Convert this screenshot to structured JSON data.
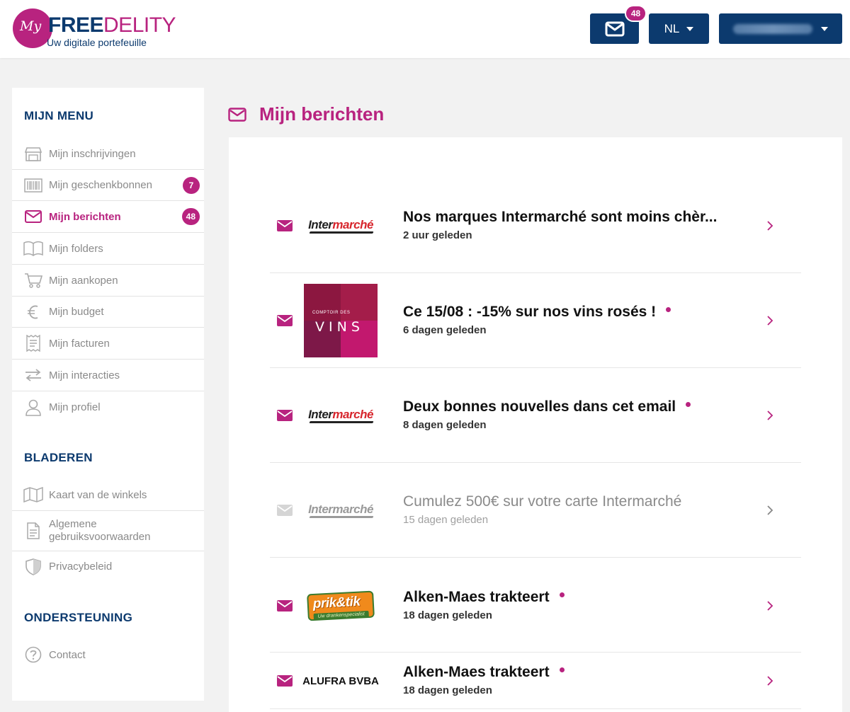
{
  "header": {
    "logo": {
      "my": "My",
      "free": "FREE",
      "delity": "DELITY",
      "tagline": "Uw digitale portefeuille"
    },
    "mail_badge": "48",
    "language": "NL",
    "user_name": "",
    "icons": {
      "mail": "envelope-icon",
      "caret": "caret-down-icon"
    }
  },
  "sidebar": {
    "menu_title": "MIJN MENU",
    "menu_items": [
      {
        "label": "Mijn inschrijvingen",
        "icon": "store-icon"
      },
      {
        "label": "Mijn geschenkbonnen",
        "icon": "barcode-icon",
        "badge": "7"
      },
      {
        "label": "Mijn berichten",
        "icon": "envelope-icon",
        "badge": "48",
        "active": true
      },
      {
        "label": "Mijn folders",
        "icon": "book-open-icon"
      },
      {
        "label": "Mijn aankopen",
        "icon": "cart-icon"
      },
      {
        "label": "Mijn budget",
        "icon": "euro-icon"
      },
      {
        "label": "Mijn facturen",
        "icon": "receipt-icon"
      },
      {
        "label": "Mijn interacties",
        "icon": "exchange-icon"
      },
      {
        "label": "Mijn profiel",
        "icon": "user-icon"
      }
    ],
    "browse_title": "BLADEREN",
    "browse_items": [
      {
        "label": "Kaart van de winkels",
        "icon": "map-icon"
      },
      {
        "label": "Algemene gebruiksvoorwaarden",
        "icon": "document-icon"
      },
      {
        "label": "Privacybeleid",
        "icon": "shield-icon"
      }
    ],
    "support_title": "ONDERSTEUNING",
    "support_items": [
      {
        "label": "Contact",
        "icon": "question-circle-icon"
      }
    ]
  },
  "main": {
    "title": "Mijn berichten",
    "messages": [
      {
        "brand": "intermarche",
        "brand_parts": [
          "Inter",
          "marché"
        ],
        "title": "Nos marques Intermarché sont moins chèr...",
        "time": "2 uur geleden",
        "unread_dot": false,
        "read": false
      },
      {
        "brand": "comptoir-des-vins",
        "brand_parts": [
          "COMPTOIR DES",
          "VINS"
        ],
        "title": "Ce 15/08 : -15% sur nos vins rosés !",
        "time": "6 dagen geleden",
        "unread_dot": true,
        "read": false
      },
      {
        "brand": "intermarche",
        "brand_parts": [
          "Inter",
          "marché"
        ],
        "title": "Deux bonnes nouvelles dans cet email",
        "time": "8 dagen geleden",
        "unread_dot": true,
        "read": false
      },
      {
        "brand": "intermarche",
        "brand_parts": [
          "Inter",
          "marché"
        ],
        "title": "Cumulez 500€ sur votre carte Intermarché",
        "time": "15 dagen geleden",
        "unread_dot": false,
        "read": true
      },
      {
        "brand": "prik-tik",
        "brand_parts": [
          "prik&tik",
          "Uw drankenspecialist"
        ],
        "title": "Alken-Maes trakteert",
        "time": "18 dagen geleden",
        "unread_dot": true,
        "read": false
      },
      {
        "brand": "alufra",
        "brand_parts": [
          "ALUFRA BVBA"
        ],
        "title": "Alken-Maes trakteert",
        "time": "18 dagen geleden",
        "unread_dot": true,
        "read": false
      }
    ]
  },
  "colors": {
    "navy": "#0c3a6e",
    "magenta": "#b8237f",
    "grey_text": "#8a8a8a",
    "background": "#f2f2f2"
  }
}
